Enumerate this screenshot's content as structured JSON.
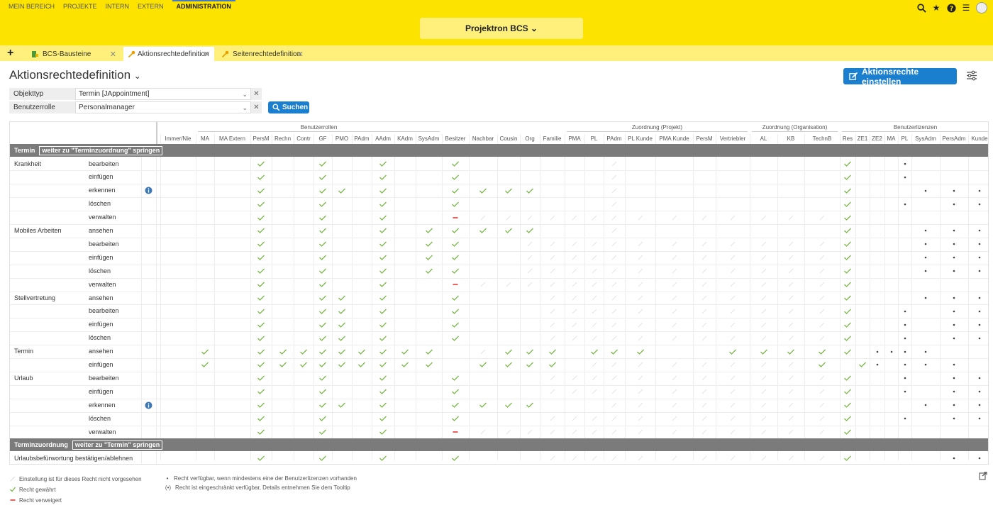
{
  "topnav": [
    "MEIN BEREICH",
    "PROJEKTE",
    "INTERN",
    "EXTERN",
    "ADMINISTRATION"
  ],
  "app_selector": "Projektron BCS",
  "tabs": [
    {
      "label": "BCS-Bausteine"
    },
    {
      "label": "Aktionsrechtedefinition"
    },
    {
      "label": "Seitenrechtedefinition"
    }
  ],
  "page_title": "Aktionsrechtedefinition",
  "set_rights_button": "Aktionsrechte einstellen",
  "filters": [
    {
      "label": "Objekttyp",
      "value": "Termin [JAppointment]"
    },
    {
      "label": "Benutzerrolle",
      "value": "Personalmanager"
    }
  ],
  "search_button": "Suchen",
  "colors": {
    "accent_yellow": "#fce300",
    "tab_bar": "#fef07a",
    "primary": "#1a7fce",
    "granted": "#7ab648",
    "denied": "#e53935",
    "section": "#7b7b7b"
  },
  "groups": [
    "Benutzerrollen",
    "Zuordnung (Projekt)",
    "Zuordnung (Organisation)",
    "Benutzerlizenzen"
  ],
  "columns": [
    "Immer/Nie",
    "MA",
    "MA Extern",
    "PersM",
    "Rechn",
    "Contr",
    "GF",
    "PMO",
    "PAdm",
    "AAdm",
    "KAdm",
    "SysAdm",
    "Besitzer",
    "Nachbar",
    "Cousin",
    "Org",
    "Familie",
    "PMA",
    "PL",
    "PAdm",
    "PL Kunde",
    "PMA Kunde",
    "PersM",
    "Vertriebler",
    "AL",
    "KB",
    "TechnB",
    "Res",
    "ZE1",
    "ZE2",
    "MA",
    "PL",
    "SysAdm",
    "PersAdm",
    "Kunde"
  ],
  "sections": [
    {
      "title": "Termin",
      "jump": "weiter zu \"Terminzuordnung\" springen",
      "rows": [
        {
          "object": "Krankheit",
          "action": "bearbeiten",
          "cells": "...g..g..g..g......n.......g...*...g.*..."
        },
        {
          "object": "",
          "action": "einfügen",
          "cells": "...g..g..g..g......n.......g...*...g.*..."
        },
        {
          "object": "",
          "action": "erkennen",
          "info": true,
          "cells": "...g..gg.g..gggg...n.......g....***..*..."
        },
        {
          "object": "",
          "action": "löschen",
          "cells": "...g..g..g..g......n.......g...*.***.*..."
        },
        {
          "object": "",
          "action": "verwalten",
          "cells": "...g..g..g..dnnnnnnnnnnnnnng.......*..."
        },
        {
          "object": "Mobiles Arbeiten",
          "action": "ansehen",
          "cells": "...g..g..g.ggggg...n.......g....***.*..."
        },
        {
          "object": "",
          "action": "bearbeiten",
          "cells": "...g..g..g.gg..nnnnnnnnnnnng....***.*..."
        },
        {
          "object": "",
          "action": "einfügen",
          "cells": "...g..g..g.gg..nnnnnnnnnnnng....***.*..."
        },
        {
          "object": "",
          "action": "löschen",
          "cells": "...g..g..g.gg..nnnnnnnnnnnng....***.*..."
        },
        {
          "object": "",
          "action": "verwalten",
          "cells": "...g..g..g..dnnnnnnnnnnnnnng.......*..."
        },
        {
          "object": "Stellvertretung",
          "action": "ansehen",
          "cells": "...g..gg.g..g...nnnnnnnnnnng....***.*..."
        },
        {
          "object": "",
          "action": "bearbeiten",
          "cells": "...g..gg.g..g...nnnnnnnnnnng...*.***.*..."
        },
        {
          "object": "",
          "action": "einfügen",
          "cells": "...g..gg.g..g...nnnnnnnnnnng...*.***.*..."
        },
        {
          "object": "",
          "action": "löschen",
          "cells": "...g..gg.g..g...nnnnnnnnnnng...*.***.*..."
        },
        {
          "object": "Termin",
          "action": "ansehen",
          "cells": ".g.ggggggggg.nggg.ggg..ggggg.****..**"
        },
        {
          "object": "",
          "action": "einfügen",
          "cells": ".g.ggggggggg.gggg.nnnnnnnng.g*.***..**"
        },
        {
          "object": "Urlaub",
          "action": "bearbeiten",
          "cells": "...g..g..g..g...nnnnnnnnnnng...*.***.*..."
        },
        {
          "object": "",
          "action": "einfügen",
          "cells": "...g..g..g..g...nnnnnnnnnnng...*.***.*..."
        },
        {
          "object": "",
          "action": "erkennen",
          "info": true,
          "cells": "...g..gg.g..gggg...nnnnnnnng....****.*..."
        },
        {
          "object": "",
          "action": "löschen",
          "cells": "...g..g..g..g...nnnnnnnnnnng...*.***.*..."
        },
        {
          "object": "",
          "action": "verwalten",
          "cells": "...g..g..g..dnnnnnnnnnnnnnng.......*..."
        }
      ]
    },
    {
      "title": "Terminzuordnung",
      "jump": "weiter zu \"Termin\" springen",
      "rows": [
        {
          "object": "Urlaubsbefürwortung bestätigen/ablehnen",
          "action": "",
          "cells": "...g..g..g..g...nnnnnnnnnnng.....***.*..."
        }
      ]
    }
  ],
  "legend": [
    "Einstellung ist für dieses Recht nicht vorgesehen",
    "Recht gewährt",
    "Recht verweigert",
    "Recht verfügbar, wenn mindestens eine der Benutzerlizenzen vorhanden",
    "Recht ist eingeschränkt verfügbar, Details entnehmen Sie dem Tooltip"
  ]
}
